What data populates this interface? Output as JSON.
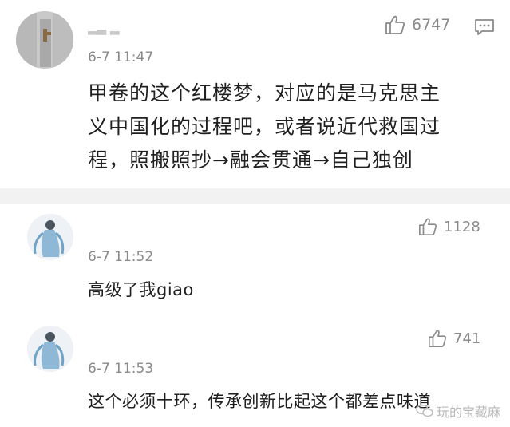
{
  "comments": [
    {
      "username": "▂▃ ▂",
      "time": "6-7 11:47",
      "likes": "6747",
      "lines": [
        "甲卷的这个红楼梦，对应的是马克思主",
        "义中国化的过程吧，或者说近代救国过",
        "程，照搬照抄→融会贯通→自己独创"
      ]
    },
    {
      "time": "6-7 11:52",
      "likes": "1128",
      "text": "高级了我giao"
    },
    {
      "time": "6-7 11:53",
      "likes": "741",
      "text": "这个必须十环，传承创新比起这个都差点味道"
    }
  ],
  "watermark": "玩的宝藏麻",
  "icons": {
    "like": "thumbs-up-icon",
    "reply": "comment-icon",
    "watermark": "wechat-icon"
  },
  "colors": {
    "divider": "#f2f2f2",
    "meta_text": "#8a8a8a",
    "body_text": "#1f1f1f"
  }
}
